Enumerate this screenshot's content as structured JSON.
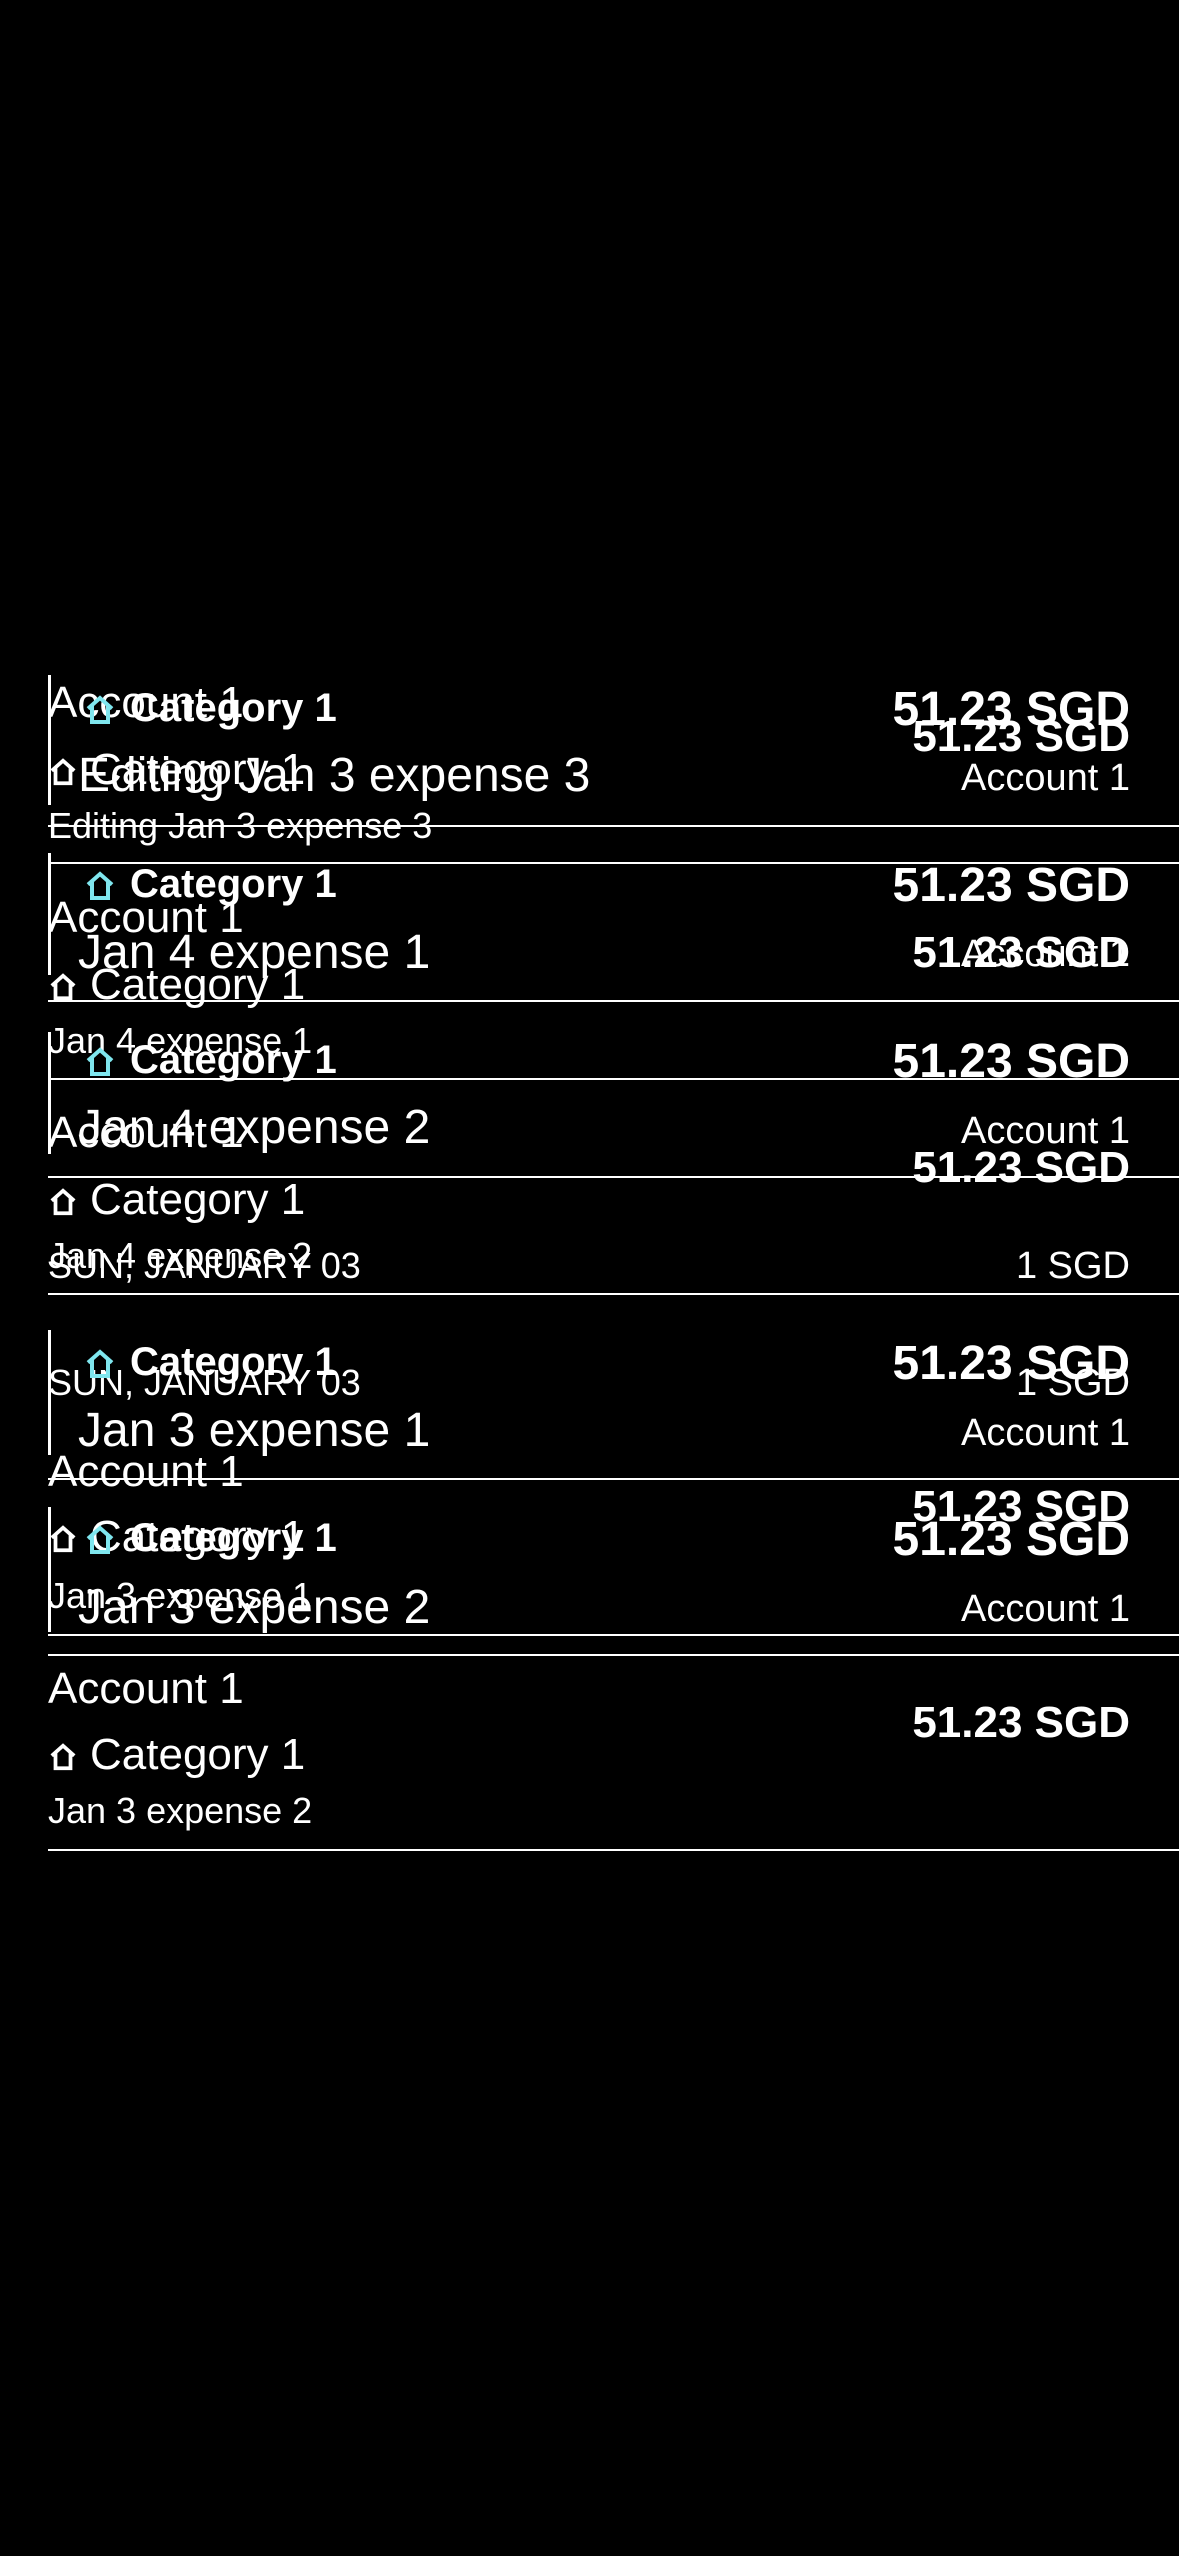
{
  "currency": "SGD",
  "colors": {
    "background": "#000000",
    "text": "#ffffff",
    "accent": "#7fe6ee"
  },
  "layer_a": {
    "rows": [
      {
        "account": "Account 1",
        "category": "Category 1",
        "note": "Editing Jan 3 expense 3",
        "amount": "51.23 SGD",
        "icon": "house-icon"
      },
      {
        "account": "Account 1",
        "category": "Category 1",
        "note": "Jan 4 expense 1",
        "amount": "51.23 SGD",
        "icon": "house-icon"
      },
      {
        "account": "Account 1",
        "category": "Category 1",
        "note": "Jan 4 expense 2",
        "amount": "51.23 SGD",
        "icon": "house-icon"
      },
      {
        "account": "Account 1",
        "category": "Category 1",
        "note": "Jan 3 expense 1",
        "amount": "51.23 SGD",
        "icon": "house-icon"
      },
      {
        "account": "Account 1",
        "category": "Category 1",
        "note": "Jan 3 expense 2",
        "amount": "51.23 SGD",
        "icon": "house-icon"
      }
    ],
    "section_header": {
      "date": "SUN, JANUARY 03",
      "total": "1 SGD"
    }
  },
  "layer_b": {
    "rows": [
      {
        "category": "Category 1",
        "note": "Editing Jan 3 expense 3",
        "amount": "51.23 SGD",
        "account": "Account 1",
        "icon": "house-icon"
      },
      {
        "category": "Category 1",
        "note": "Jan 4 expense 1",
        "amount": "51.23 SGD",
        "account": "Account 1",
        "icon": "house-icon"
      },
      {
        "category": "Category 1",
        "note": "Jan 4 expense 2",
        "amount": "51.23 SGD",
        "account": "Account 1",
        "icon": "house-icon"
      },
      {
        "category": "Category 1",
        "note": "Jan 3 expense 1",
        "amount": "51.23 SGD",
        "account": "Account 1",
        "icon": "house-icon"
      },
      {
        "category": "Category 1",
        "note": "Jan 3 expense 2",
        "amount": "51.23 SGD",
        "account": "Account 1",
        "icon": "house-icon"
      }
    ],
    "section_header": {
      "date": "SUN, JANUARY 03",
      "total": "1 SGD"
    }
  }
}
